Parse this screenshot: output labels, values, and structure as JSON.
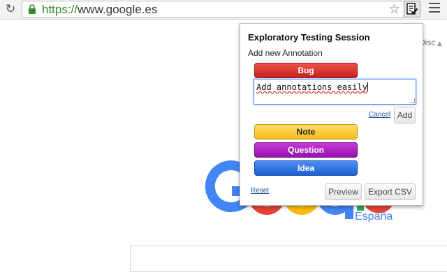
{
  "browser": {
    "url_scheme": "https://",
    "url_host": "www.google.es"
  },
  "page": {
    "region_label": "España",
    "side_text": "Disc"
  },
  "popup": {
    "title": "Exploratory Testing Session",
    "subtitle": "Add new Annotation",
    "bug_label": "Bug",
    "annotation_value": "Add annotations easily",
    "cancel_label": "Cancel",
    "add_label": "Add",
    "note_label": "Note",
    "question_label": "Question",
    "idea_label": "Idea",
    "reset_label": "Reset",
    "preview_label": "Preview",
    "export_label": "Export CSV"
  },
  "colors": {
    "bug": "#d9342b",
    "note": "#fcd03e",
    "question": "#b324c4",
    "idea": "#2f74e0",
    "google_blue": "#4285f4",
    "google_red": "#ea4335",
    "google_yellow": "#fbbc05",
    "google_green": "#34a853"
  }
}
